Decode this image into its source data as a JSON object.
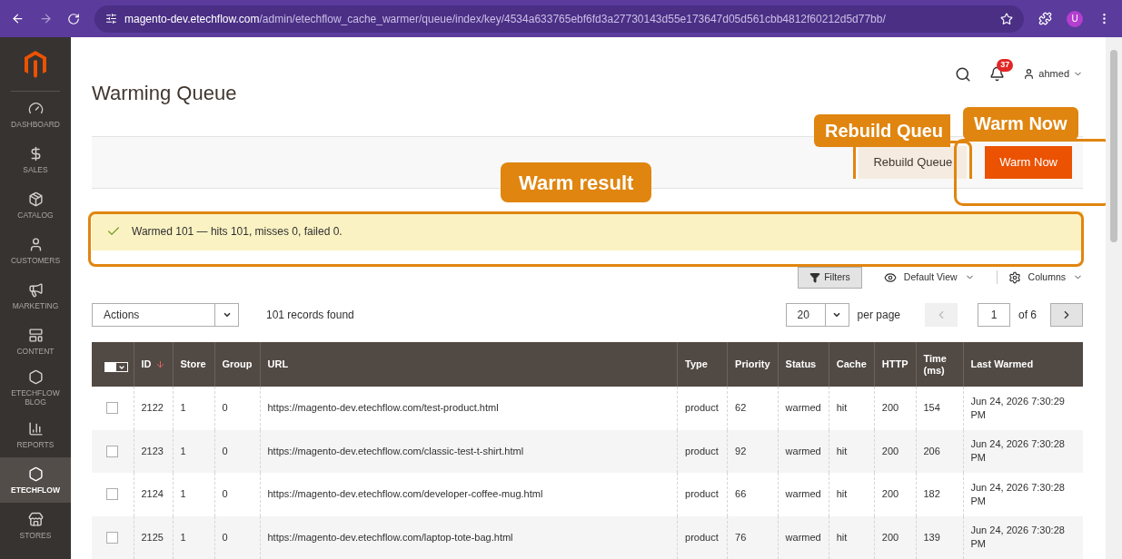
{
  "browser": {
    "url_host": "magento-dev.etechflow.com",
    "url_path": "/admin/etechflow_cache_warmer/queue/index/key/4534a633765ebf6fd3a27730143d55e173647d05d561cbb4812f60212d5d77bb/",
    "profile": "U"
  },
  "sidebar": {
    "items": [
      {
        "label": "DASHBOARD",
        "kind": "gauge",
        "selected": false
      },
      {
        "label": "SALES",
        "kind": "dollar",
        "selected": false
      },
      {
        "label": "CATALOG",
        "kind": "box",
        "selected": false
      },
      {
        "label": "CUSTOMERS",
        "kind": "person",
        "selected": false
      },
      {
        "label": "MARKETING",
        "kind": "megaphone",
        "selected": false
      },
      {
        "label": "CONTENT",
        "kind": "layout",
        "selected": false
      },
      {
        "label": "ETECHFLOW BLOG",
        "kind": "hexagon",
        "selected": false
      },
      {
        "label": "REPORTS",
        "kind": "bars",
        "selected": false
      },
      {
        "label": "ETECHFLOW",
        "kind": "hexagon",
        "selected": true
      },
      {
        "label": "STORES",
        "kind": "store",
        "selected": false
      }
    ]
  },
  "header": {
    "title": "Warming Queue",
    "notifications": "37",
    "user": "ahmed"
  },
  "page_actions": [
    {
      "label": "Rebuild Queue",
      "kind": "secondary"
    },
    {
      "label": "Warm Now",
      "kind": "primary"
    }
  ],
  "message": {
    "text": "Warmed 101 — hits 101, misses 0, failed 0."
  },
  "toolbar": {
    "filters": "Filters",
    "view": "Default View",
    "columns": "Columns"
  },
  "grid": {
    "actions": "Actions",
    "records": "101 records found",
    "per_page": "20",
    "per_page_label": "per page",
    "page": "1",
    "of_pages": "of 6"
  },
  "table": {
    "select_all_checked": false,
    "columns": [
      {
        "label": "ID",
        "sorted": true
      },
      {
        "label": "Store",
        "sorted": false
      },
      {
        "label": "Group",
        "sorted": false
      },
      {
        "label": "URL",
        "sorted": false
      },
      {
        "label": "Type",
        "sorted": false
      },
      {
        "label": "Priority",
        "sorted": false
      },
      {
        "label": "Status",
        "sorted": false
      },
      {
        "label": "Cache",
        "sorted": false
      },
      {
        "label": "HTTP",
        "sorted": false
      },
      {
        "label": "Time (ms)",
        "sorted": false
      },
      {
        "label": "Last Warmed",
        "sorted": false
      }
    ],
    "rows": [
      {
        "checked": false,
        "cells": [
          "2122",
          "1",
          "0",
          "https://magento-dev.etechflow.com/test-product.html",
          "product",
          "62",
          "warmed",
          "hit",
          "200",
          "154",
          "Jun 24, 2026 7:30:29 PM"
        ]
      },
      {
        "checked": false,
        "cells": [
          "2123",
          "1",
          "0",
          "https://magento-dev.etechflow.com/classic-test-t-shirt.html",
          "product",
          "92",
          "warmed",
          "hit",
          "200",
          "206",
          "Jun 24, 2026 7:30:28 PM"
        ]
      },
      {
        "checked": false,
        "cells": [
          "2124",
          "1",
          "0",
          "https://magento-dev.etechflow.com/developer-coffee-mug.html",
          "product",
          "66",
          "warmed",
          "hit",
          "200",
          "182",
          "Jun 24, 2026 7:30:28 PM"
        ]
      },
      {
        "checked": false,
        "cells": [
          "2125",
          "1",
          "0",
          "https://magento-dev.etechflow.com/laptop-tote-bag.html",
          "product",
          "76",
          "warmed",
          "hit",
          "200",
          "139",
          "Jun 24, 2026 7:30:28 PM"
        ]
      }
    ]
  },
  "annotations": [
    {
      "text": "Rebuild Queu"
    },
    {
      "text": "Warm Now"
    },
    {
      "text": "Warm result"
    }
  ]
}
